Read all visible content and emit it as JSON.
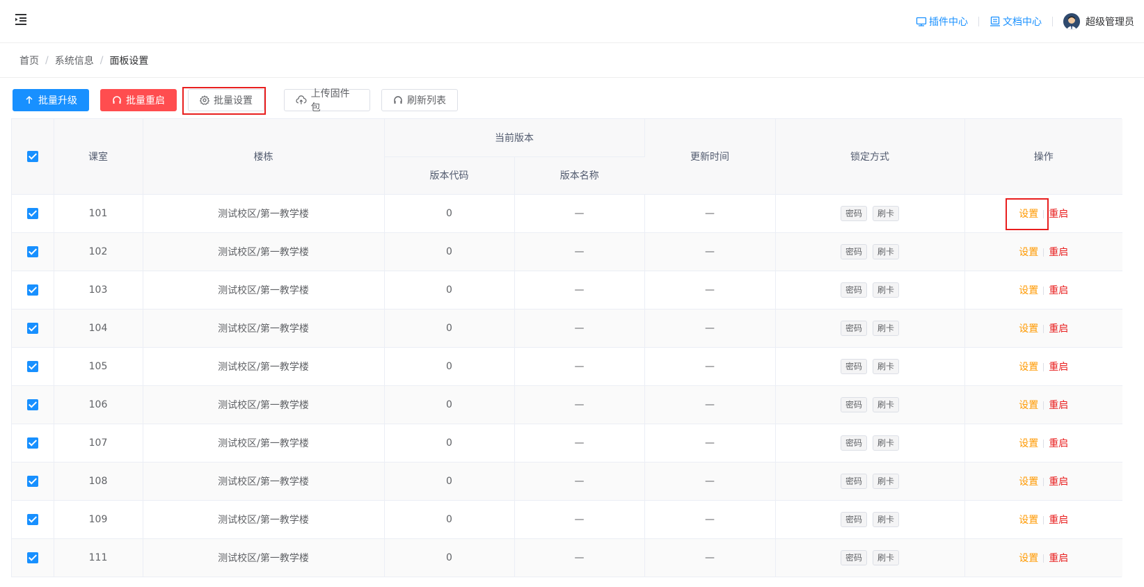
{
  "header": {
    "plugin_center": "插件中心",
    "doc_center": "文档中心",
    "user_name": "超级管理员",
    "accent_color": "#1890ff"
  },
  "breadcrumb": {
    "items": [
      "首页",
      "系统信息",
      "面板设置"
    ],
    "separator": "/"
  },
  "toolbar": {
    "batch_upgrade": "批量升级",
    "batch_restart": "批量重启",
    "batch_settings": "批量设置",
    "upload_firmware": "上传固件包",
    "refresh_list": "刷新列表"
  },
  "table": {
    "headers": {
      "classroom": "课室",
      "building": "楼栋",
      "current_version": "当前版本",
      "version_code": "版本代码",
      "version_name": "版本名称",
      "update_time": "更新时间",
      "lock_mode": "锁定方式",
      "actions": "操作"
    },
    "rows": [
      {
        "classroom": "101",
        "building": "测试校区/第一教学楼",
        "version_code": "0",
        "version_name": "—",
        "update_time": "—",
        "lock_password": "密码",
        "lock_card": "刷卡",
        "action_set": "设置",
        "action_restart": "重启",
        "checked": true
      },
      {
        "classroom": "102",
        "building": "测试校区/第一教学楼",
        "version_code": "0",
        "version_name": "—",
        "update_time": "—",
        "lock_password": "密码",
        "lock_card": "刷卡",
        "action_set": "设置",
        "action_restart": "重启",
        "checked": true
      },
      {
        "classroom": "103",
        "building": "测试校区/第一教学楼",
        "version_code": "0",
        "version_name": "—",
        "update_time": "—",
        "lock_password": "密码",
        "lock_card": "刷卡",
        "action_set": "设置",
        "action_restart": "重启",
        "checked": true
      },
      {
        "classroom": "104",
        "building": "测试校区/第一教学楼",
        "version_code": "0",
        "version_name": "—",
        "update_time": "—",
        "lock_password": "密码",
        "lock_card": "刷卡",
        "action_set": "设置",
        "action_restart": "重启",
        "checked": true
      },
      {
        "classroom": "105",
        "building": "测试校区/第一教学楼",
        "version_code": "0",
        "version_name": "—",
        "update_time": "—",
        "lock_password": "密码",
        "lock_card": "刷卡",
        "action_set": "设置",
        "action_restart": "重启",
        "checked": true
      },
      {
        "classroom": "106",
        "building": "测试校区/第一教学楼",
        "version_code": "0",
        "version_name": "—",
        "update_time": "—",
        "lock_password": "密码",
        "lock_card": "刷卡",
        "action_set": "设置",
        "action_restart": "重启",
        "checked": true
      },
      {
        "classroom": "107",
        "building": "测试校区/第一教学楼",
        "version_code": "0",
        "version_name": "—",
        "update_time": "—",
        "lock_password": "密码",
        "lock_card": "刷卡",
        "action_set": "设置",
        "action_restart": "重启",
        "checked": true
      },
      {
        "classroom": "108",
        "building": "测试校区/第一教学楼",
        "version_code": "0",
        "version_name": "—",
        "update_time": "—",
        "lock_password": "密码",
        "lock_card": "刷卡",
        "action_set": "设置",
        "action_restart": "重启",
        "checked": true
      },
      {
        "classroom": "109",
        "building": "测试校区/第一教学楼",
        "version_code": "0",
        "version_name": "—",
        "update_time": "—",
        "lock_password": "密码",
        "lock_card": "刷卡",
        "action_set": "设置",
        "action_restart": "重启",
        "checked": true
      },
      {
        "classroom": "111",
        "building": "测试校区/第一教学楼",
        "version_code": "0",
        "version_name": "—",
        "update_time": "—",
        "lock_password": "密码",
        "lock_card": "刷卡",
        "action_set": "设置",
        "action_restart": "重启",
        "checked": true
      }
    ]
  }
}
